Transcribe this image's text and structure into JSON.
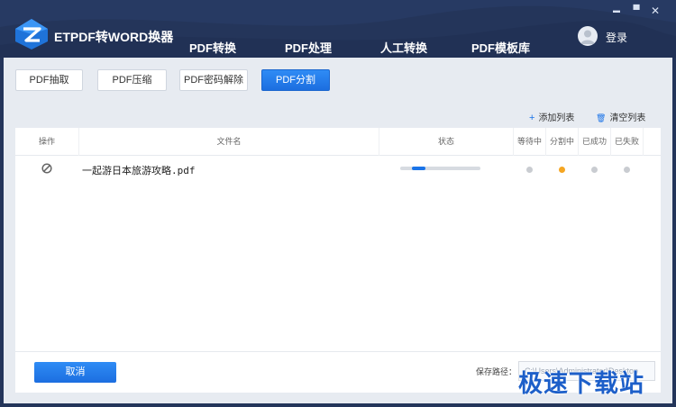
{
  "app": {
    "title": "ETPDF转WORD换器"
  },
  "window_controls": {
    "minimize": "▬",
    "maximize": "▀",
    "close": "✕"
  },
  "nav": {
    "tabs": [
      {
        "label": "PDF转换",
        "active": false
      },
      {
        "label": "PDF处理",
        "active": true
      },
      {
        "label": "人工转换",
        "active": false
      },
      {
        "label": "PDF模板库",
        "active": false
      }
    ]
  },
  "user": {
    "login_label": "登录",
    "avatar_icon": "user-avatar-icon"
  },
  "subtabs": [
    {
      "label": "PDF抽取",
      "active": false
    },
    {
      "label": "PDF压缩",
      "active": false
    },
    {
      "label": "PDF密码解除",
      "active": false
    },
    {
      "label": "PDF分割",
      "active": true
    }
  ],
  "actions": {
    "add_list": {
      "icon": "+",
      "label": "添加列表"
    },
    "clear_list": {
      "icon": "🗑",
      "label": "清空列表"
    }
  },
  "table": {
    "columns": [
      "操作",
      "文件名",
      "状态",
      "等待中",
      "分割中",
      "已成功",
      "已失败"
    ],
    "rows": [
      {
        "filename": "一起游日本旅游攻略.pdf",
        "progress": 0.17,
        "status_dots": [
          "#c9ccd1",
          "#f5a623",
          "#c9ccd1",
          "#c9ccd1"
        ]
      }
    ]
  },
  "footer": {
    "cancel_label": "取消",
    "save_path_label": "保存路径：",
    "save_path_value": "C:\\Users\\Administrator\\Desktop"
  },
  "watermark": {
    "text": "极速下载站"
  },
  "colors": {
    "header": "#24355a",
    "accent": "#1a73e8",
    "active_dot": "#f5a623"
  }
}
